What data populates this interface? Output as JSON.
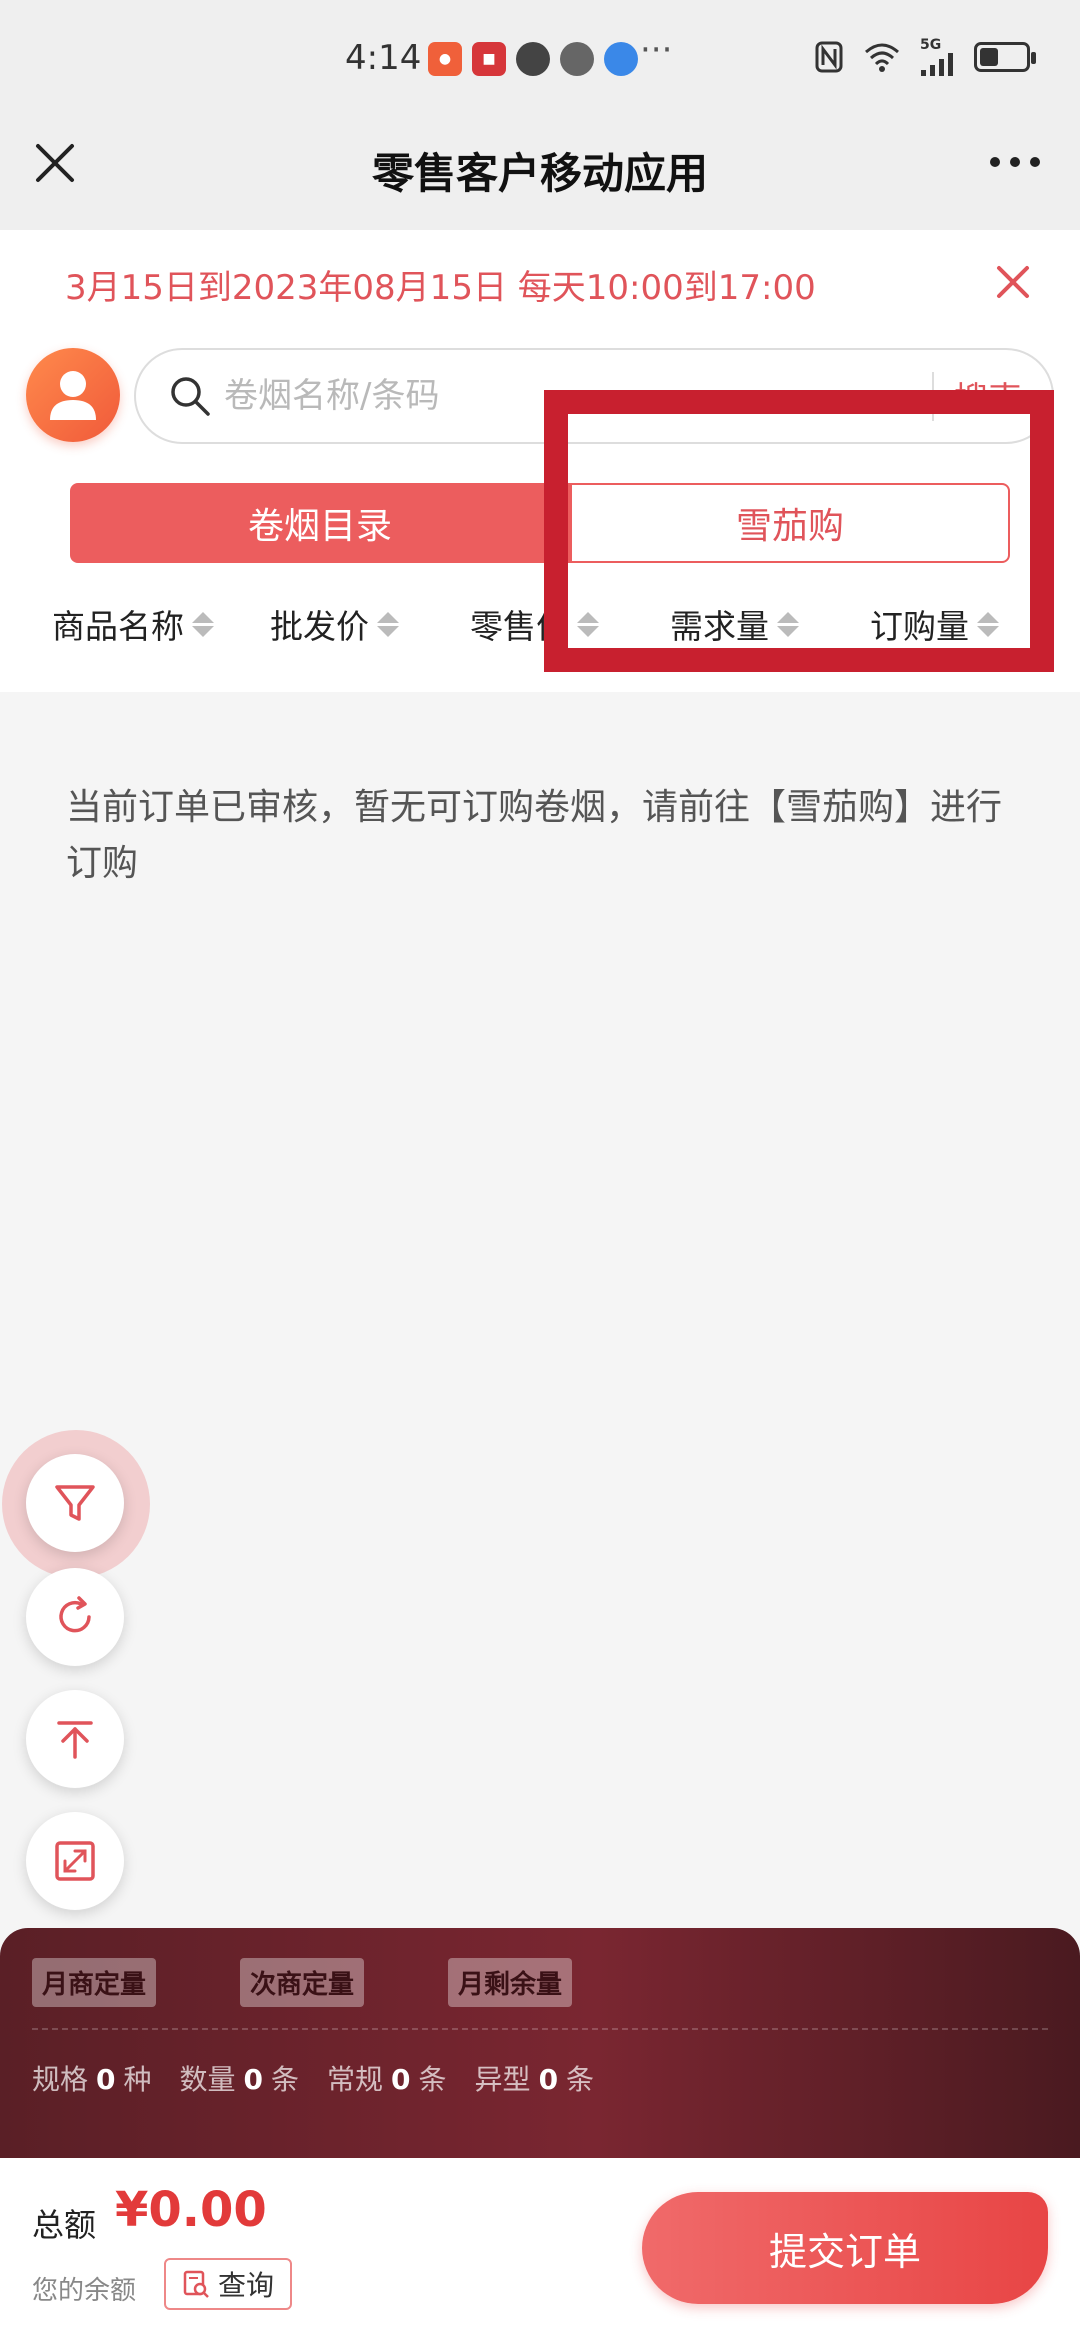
{
  "status": {
    "time": "4:14",
    "network": "5G",
    "battery_level": 0.4,
    "more": "···"
  },
  "titlebar": {
    "title": "零售客户移动应用"
  },
  "notice": {
    "text": "3月15日到2023年08月15日 每天10:00到17:00"
  },
  "search": {
    "placeholder": "卷烟名称/条码",
    "button_label": "搜索"
  },
  "tabs": [
    {
      "label": "卷烟目录",
      "active": true
    },
    {
      "label": "雪茄购",
      "active": false
    }
  ],
  "columns": [
    "商品名称",
    "批发价",
    "零售价",
    "需求量",
    "订购量"
  ],
  "empty_message": "当前订单已审核，暂无可订购卷烟，请前往【雪茄购】进行订购",
  "quota": {
    "tags": [
      "月商定量",
      "次商定量",
      "月剩余量"
    ],
    "stats": [
      {
        "label": "规格",
        "value": "0",
        "unit": "种"
      },
      {
        "label": "数量",
        "value": "0",
        "unit": "条"
      },
      {
        "label": "常规",
        "value": "0",
        "unit": "条"
      },
      {
        "label": "异型",
        "value": "0",
        "unit": "条"
      }
    ]
  },
  "footer": {
    "total_label": "总额",
    "total_amount": "¥0.00",
    "balance_label": "您的余额",
    "query_label": "查询",
    "submit_label": "提交订单"
  },
  "colors": {
    "accent": "#ec5d5e",
    "highlight": "#c8202f",
    "panel": "#6a232c"
  }
}
